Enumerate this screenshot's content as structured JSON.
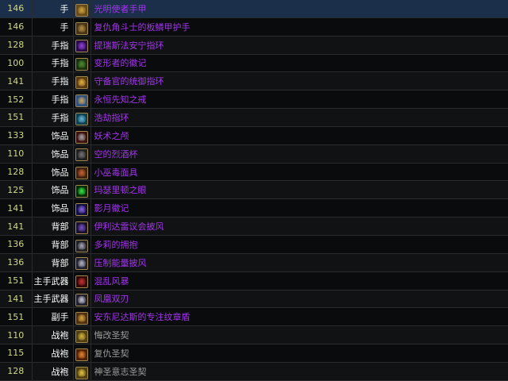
{
  "items": [
    {
      "level": "146",
      "slot": "手",
      "name": "光明使者手甲",
      "quality": "epic",
      "icon": "gauntlet-gold-icon",
      "icon_colors": [
        "#c8a040",
        "#6a4a18"
      ]
    },
    {
      "level": "146",
      "slot": "手",
      "name": "复仇角斗士的板鳞甲护手",
      "quality": "epic",
      "icon": "gauntlet-bronze-icon",
      "icon_colors": [
        "#b08a40",
        "#4a3418"
      ]
    },
    {
      "level": "128",
      "slot": "手指",
      "name": "提瑞斯法安宁指环",
      "quality": "epic",
      "icon": "ring-purple-icon",
      "icon_colors": [
        "#8a40d0",
        "#2a0a4a"
      ]
    },
    {
      "level": "100",
      "slot": "手指",
      "name": "变形者的徽记",
      "quality": "epic",
      "icon": "ring-green-icon",
      "icon_colors": [
        "#4a8a30",
        "#1a3010"
      ]
    },
    {
      "level": "141",
      "slot": "手指",
      "name": "守备官的统御指环",
      "quality": "epic",
      "icon": "ring-gold-icon",
      "icon_colors": [
        "#e0b040",
        "#5a3a10"
      ]
    },
    {
      "level": "152",
      "slot": "手指",
      "name": "永恒先知之戒",
      "quality": "epic",
      "icon": "ring-blue-icon",
      "icon_colors": [
        "#c0a060",
        "#305080"
      ]
    },
    {
      "level": "151",
      "slot": "手指",
      "name": "浩劫指环",
      "quality": "epic",
      "icon": "ring-cyan-icon",
      "icon_colors": [
        "#60b0d0",
        "#104050"
      ]
    },
    {
      "level": "133",
      "slot": "饰品",
      "name": "妖术之颅",
      "quality": "epic",
      "icon": "skull-icon",
      "icon_colors": [
        "#a0a0a0",
        "#401010"
      ]
    },
    {
      "level": "110",
      "slot": "饰品",
      "name": "空的烈酒杯",
      "quality": "epic",
      "icon": "mug-icon",
      "icon_colors": [
        "#707070",
        "#202020"
      ]
    },
    {
      "level": "128",
      "slot": "饰品",
      "name": "小巫毒面具",
      "quality": "epic",
      "icon": "mask-icon",
      "icon_colors": [
        "#c06030",
        "#402010"
      ]
    },
    {
      "level": "125",
      "slot": "饰品",
      "name": "玛瑟里顿之眼",
      "quality": "epic",
      "icon": "eye-orb-icon",
      "icon_colors": [
        "#30e040",
        "#052a08"
      ]
    },
    {
      "level": "141",
      "slot": "饰品",
      "name": "影月徽记",
      "quality": "epic",
      "icon": "moon-sigil-icon",
      "icon_colors": [
        "#8060e0",
        "#101040"
      ]
    },
    {
      "level": "141",
      "slot": "背部",
      "name": "伊利达雷议会披风",
      "quality": "epic",
      "icon": "cloak-purple-icon",
      "icon_colors": [
        "#7050c0",
        "#1a1030"
      ]
    },
    {
      "level": "136",
      "slot": "背部",
      "name": "多莉的拥抱",
      "quality": "epic",
      "icon": "cloak-grey-icon",
      "icon_colors": [
        "#a0a0b0",
        "#202028"
      ]
    },
    {
      "level": "136",
      "slot": "背部",
      "name": "压制能量披风",
      "quality": "epic",
      "icon": "cloak-silver-icon",
      "icon_colors": [
        "#b0b0c0",
        "#202030"
      ]
    },
    {
      "level": "151",
      "slot": "主手武器",
      "name": "混乱风暴",
      "quality": "epic",
      "icon": "axe-red-icon",
      "icon_colors": [
        "#c03030",
        "#300808"
      ]
    },
    {
      "level": "141",
      "slot": "主手武器",
      "name": "凤凰双刃",
      "quality": "epic",
      "icon": "blade-icon",
      "icon_colors": [
        "#c0c0d0",
        "#202030"
      ]
    },
    {
      "level": "151",
      "slot": "副手",
      "name": "安东尼达斯的专注纹章盾",
      "quality": "epic",
      "icon": "shield-icon",
      "icon_colors": [
        "#d0a040",
        "#503010"
      ]
    },
    {
      "level": "110",
      "slot": "战袍",
      "name": "悔改圣契",
      "quality": "common",
      "icon": "libram-icon",
      "icon_colors": [
        "#d0b040",
        "#504010"
      ]
    },
    {
      "level": "115",
      "slot": "战袍",
      "name": "复仇圣契",
      "quality": "common",
      "icon": "libram-orange-icon",
      "icon_colors": [
        "#e08030",
        "#502008"
      ]
    },
    {
      "level": "128",
      "slot": "战袍",
      "name": "神圣意志圣契",
      "quality": "common",
      "icon": "libram-yellow-icon",
      "icon_colors": [
        "#e0c040",
        "#504010"
      ]
    }
  ],
  "selected_row": 0,
  "colors": {
    "epic": "#a335ee",
    "common": "#9d9d9d",
    "level": "#d2d88a",
    "selected_row_bg": "#1b2e4a"
  }
}
